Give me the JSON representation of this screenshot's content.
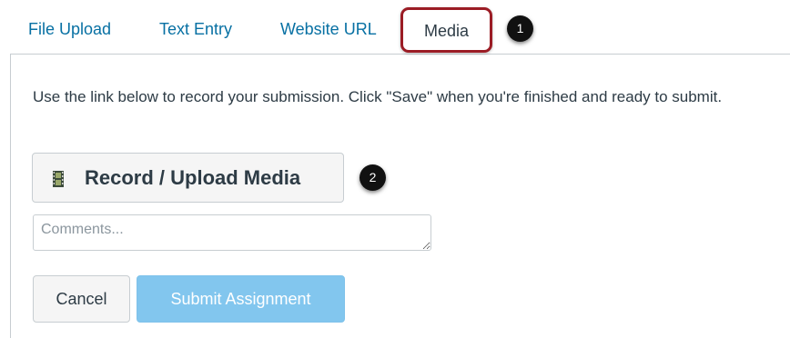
{
  "tabs": [
    {
      "label": "File Upload",
      "active": false
    },
    {
      "label": "Text Entry",
      "active": false
    },
    {
      "label": "Website URL",
      "active": false
    },
    {
      "label": "Media",
      "active": true
    }
  ],
  "callouts": [
    "1",
    "2"
  ],
  "instructions": "Use the link below to record your submission. Click \"Save\" when you're finished and ready to submit.",
  "record_button": {
    "label": "Record / Upload Media",
    "icon": "film-icon"
  },
  "comments": {
    "placeholder": "Comments...",
    "value": ""
  },
  "actions": {
    "cancel_label": "Cancel",
    "submit_label": "Submit Assignment",
    "submit_enabled": false
  },
  "colors": {
    "link": "#0770a3",
    "highlight_border": "#9b1c25",
    "submit_disabled_bg": "#82c6ee",
    "badge_bg": "#111111"
  }
}
